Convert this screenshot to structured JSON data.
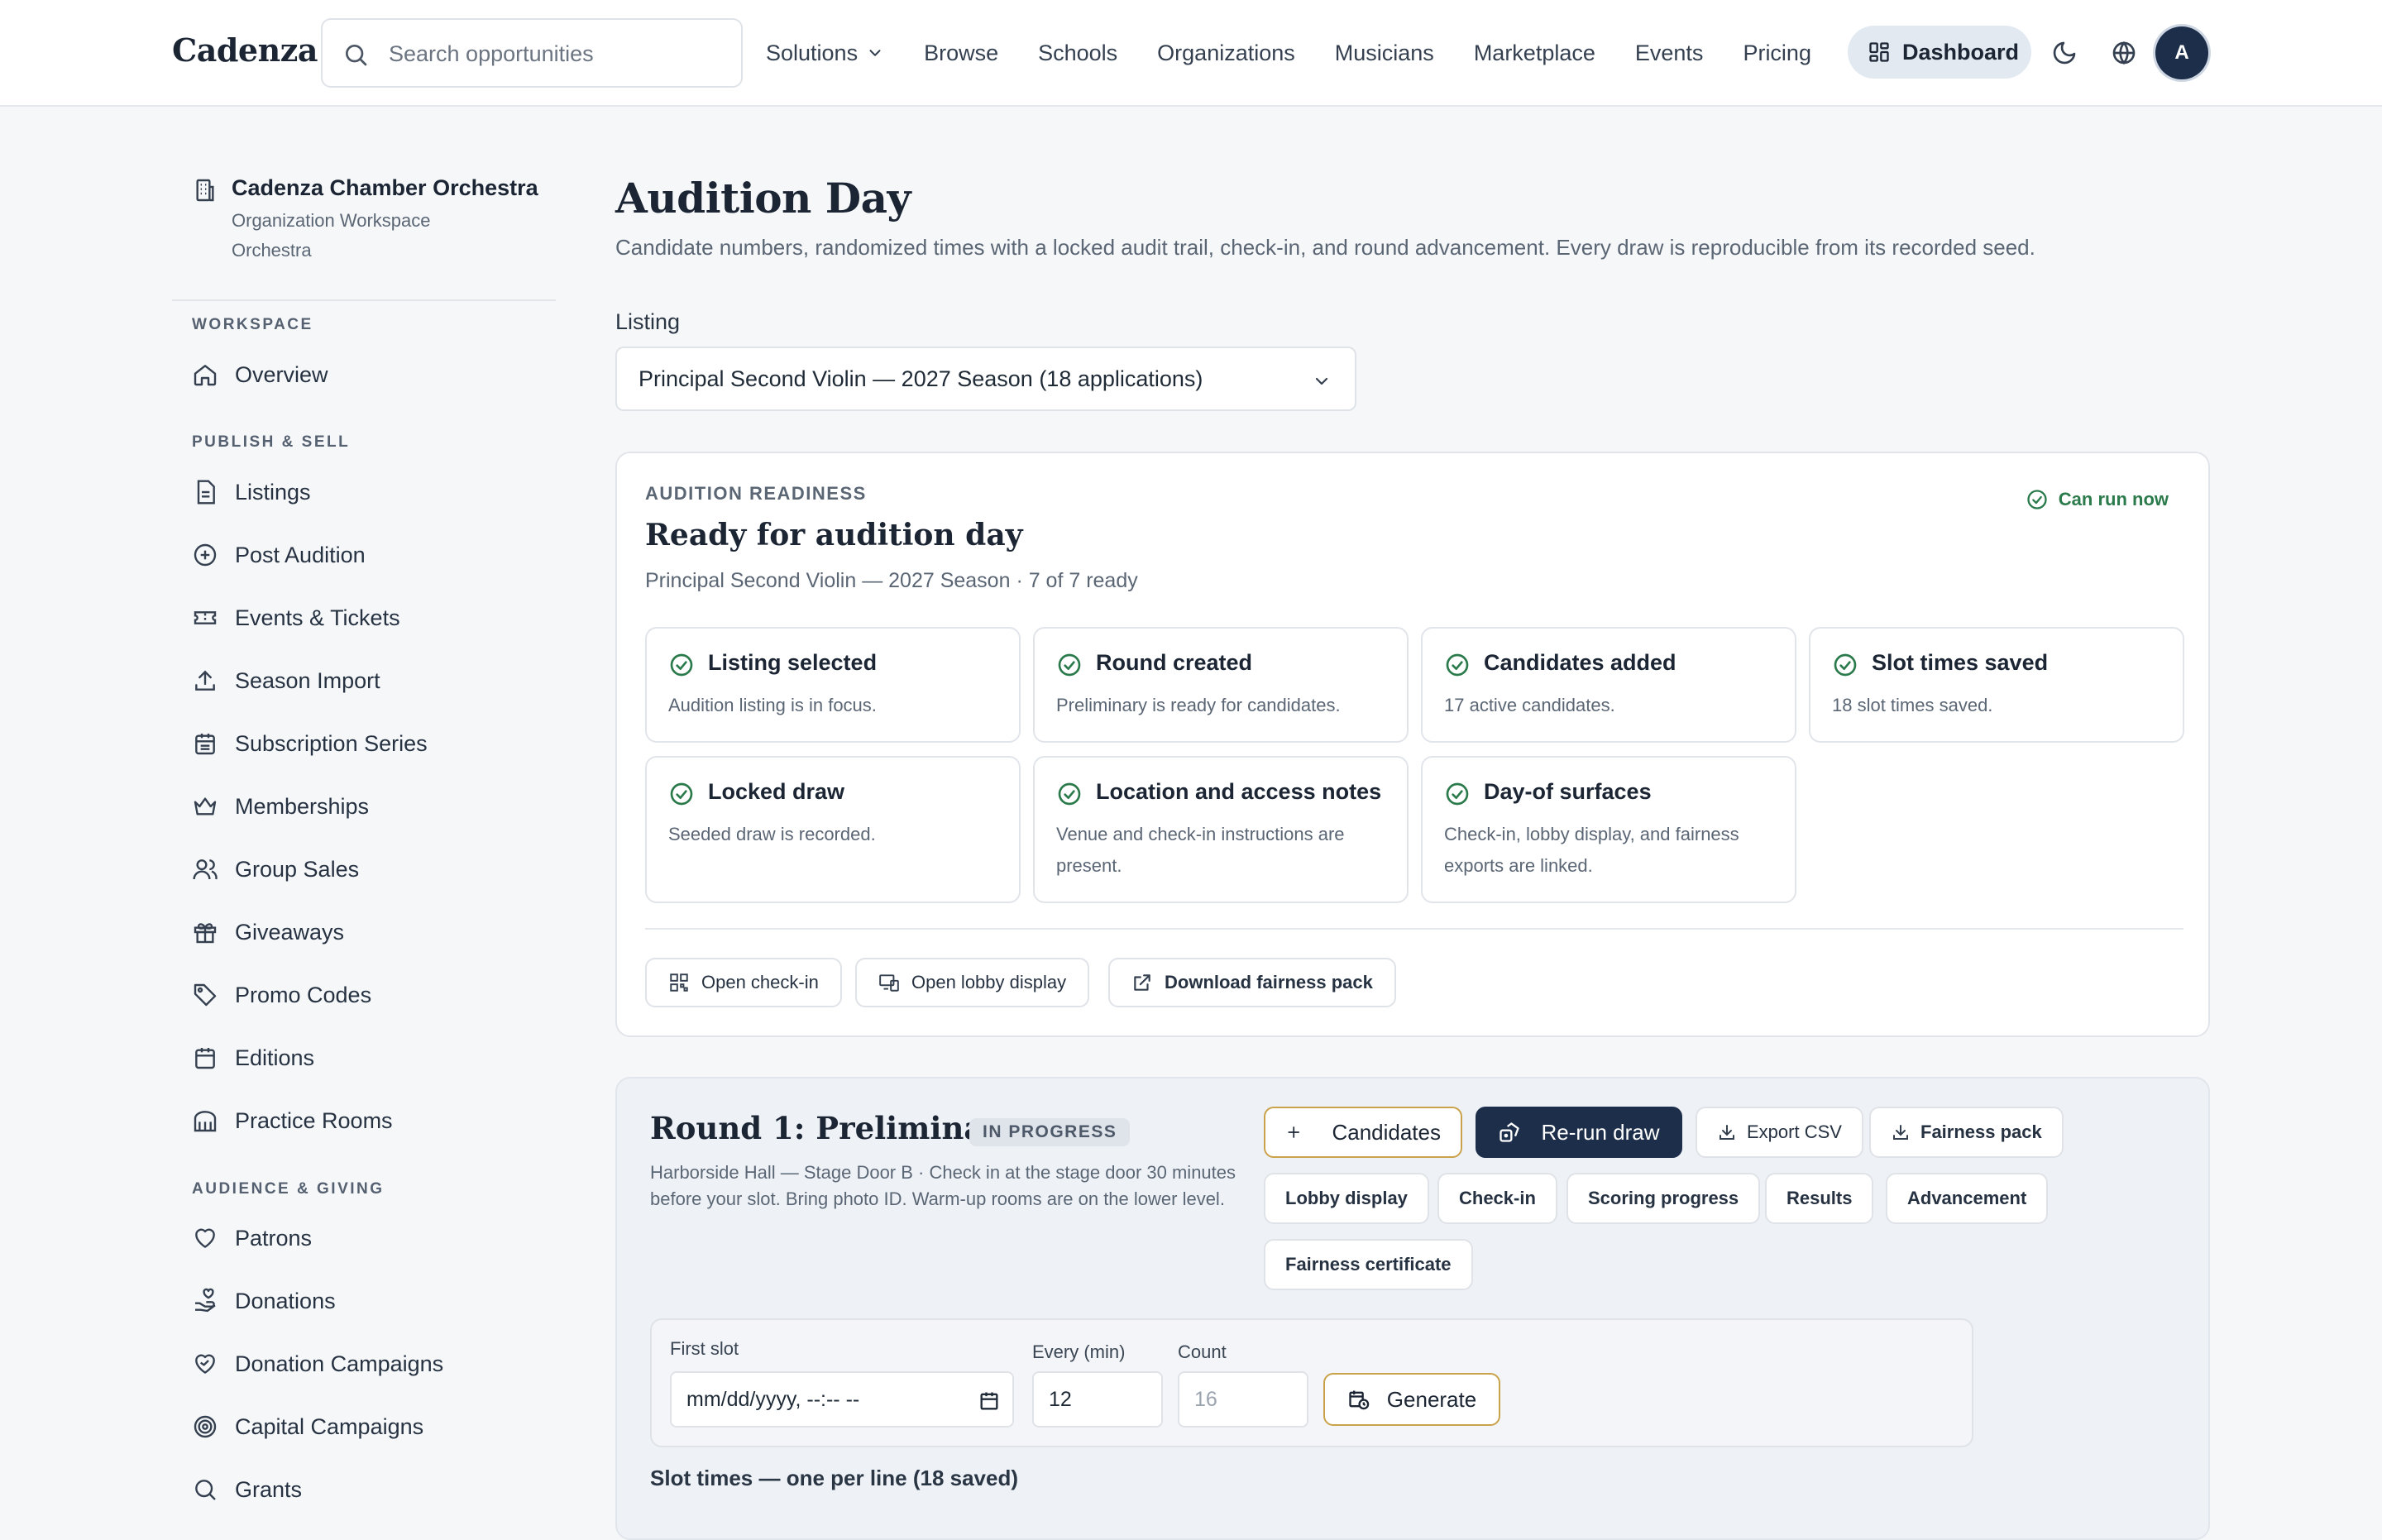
{
  "header": {
    "brand": "Cadenza",
    "search_placeholder": "Search opportunities",
    "nav": [
      "Solutions",
      "Browse",
      "Schools",
      "Organizations",
      "Musicians",
      "Marketplace",
      "Events",
      "Pricing"
    ],
    "dashboard_label": "Dashboard",
    "avatar_initial": "A"
  },
  "sidebar": {
    "org_name": "Cadenza Chamber Orchestra",
    "org_workspace": "Organization Workspace",
    "org_type": "Orchestra",
    "sections": [
      {
        "heading": "WORKSPACE",
        "items": [
          "Overview"
        ]
      },
      {
        "heading": "PUBLISH & SELL",
        "items": [
          "Listings",
          "Post Audition",
          "Events & Tickets",
          "Season Import",
          "Subscription Series",
          "Memberships",
          "Group Sales",
          "Giveaways",
          "Promo Codes",
          "Editions",
          "Practice Rooms"
        ]
      },
      {
        "heading": "AUDIENCE & GIVING",
        "items": [
          "Patrons",
          "Donations",
          "Donation Campaigns",
          "Capital Campaigns",
          "Grants"
        ]
      }
    ]
  },
  "main": {
    "title": "Audition Day",
    "description": "Candidate numbers, randomized times with a locked audit trail, check-in, and round advancement. Every draw is reproducible from its recorded seed.",
    "listing_label": "Listing",
    "listing_value": "Principal Second Violin — 2027 Season (18 applications)"
  },
  "readiness": {
    "kicker": "AUDITION READINESS",
    "title": "Ready for audition day",
    "subtitle": "Principal Second Violin — 2027 Season · 7 of 7 ready",
    "status": "Can run now",
    "checks": [
      {
        "title": "Listing selected",
        "desc": "Audition listing is in focus."
      },
      {
        "title": "Round created",
        "desc": "Preliminary is ready for candidates."
      },
      {
        "title": "Candidates added",
        "desc": "17 active candidates."
      },
      {
        "title": "Slot times saved",
        "desc": "18 slot times saved."
      },
      {
        "title": "Locked draw",
        "desc": "Seeded draw is recorded."
      },
      {
        "title": "Location and access notes",
        "desc": "Venue and check-in instructions are present."
      },
      {
        "title": "Day-of surfaces",
        "desc": "Check-in, lobby display, and fairness exports are linked."
      }
    ],
    "actions": [
      "Open check-in",
      "Open lobby display",
      "Download fairness pack"
    ]
  },
  "round": {
    "title": "Round 1: Preliminary",
    "status": "IN PROGRESS",
    "description": "Harborside Hall — Stage Door B · Check in at the stage door 30 minutes before your slot. Bring photo ID. Warm-up rooms are on the lower level.",
    "buttons": {
      "candidates": "Candidates",
      "rerun": "Re-run draw",
      "export_csv": "Export CSV",
      "fairness_pack": "Fairness pack",
      "lobby_display": "Lobby display",
      "check_in": "Check-in",
      "scoring_progress": "Scoring progress",
      "results": "Results",
      "advancement": "Advancement",
      "fairness_certificate": "Fairness certificate",
      "generate": "Generate"
    },
    "slot_form": {
      "first_slot_label": "First slot",
      "first_slot_value": "mm/dd/yyyy, --:-- --",
      "every_label": "Every (min)",
      "every_value": "12",
      "count_label": "Count",
      "count_placeholder": "16"
    },
    "slots_label": "Slot times — one per line (18 saved)"
  },
  "colors": {
    "accent_dark": "#1d2e4a",
    "success": "#2a7a4b",
    "gold": "#c9a24a"
  }
}
